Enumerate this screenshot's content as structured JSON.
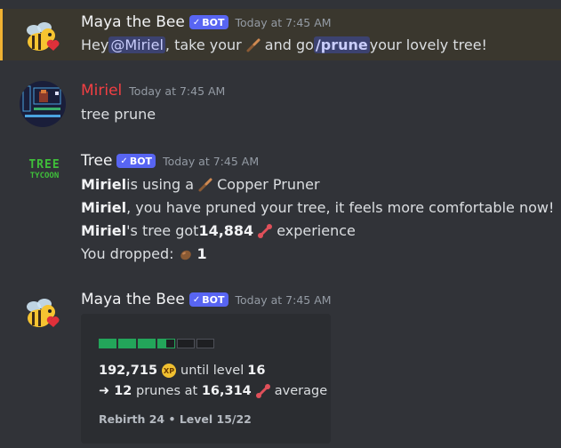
{
  "messages": [
    {
      "author": "Maya the Bee",
      "badge": "BOT",
      "timestamp": "Today at 7:45 AM",
      "line": {
        "p1": "Hey ",
        "mention": "@Miriel",
        "p2": ", take your ",
        "p3": " and go ",
        "command": "/prune",
        "p4": " your lovely tree!"
      }
    },
    {
      "author": "Miriel",
      "timestamp": "Today at 7:45 AM",
      "text": "tree prune"
    },
    {
      "author": "Tree",
      "badge": "BOT",
      "timestamp": "Today at 7:45 AM",
      "avatar_text_top": "TREE",
      "avatar_text_bottom": "TYCOON",
      "lines": {
        "l1_user": "Miriel",
        "l1_text": " is using a ",
        "l1_item": " Copper Pruner",
        "l2_user": "Miriel",
        "l2_text": ", you have pruned your tree, it feels more comfortable now!",
        "l3_user": "Miriel",
        "l3_text": "'s tree got ",
        "l3_amount": "14,884",
        "l3_suffix": " experience",
        "l4_text": "You dropped: ",
        "l4_amount": "1"
      }
    },
    {
      "author": "Maya the Bee",
      "badge": "BOT",
      "timestamp": "Today at 7:45 AM",
      "embed": {
        "progress_segments_filled": 3.5,
        "progress_segments_total": 6,
        "xp_remaining": "192,715",
        "xp_icon_label": "XP",
        "until_text": " until level ",
        "next_level": "16",
        "arrow": "➜ ",
        "prunes": "12",
        "prunes_text": " prunes at ",
        "avg_xp": "16,314",
        "average_text": " average",
        "footer": "Rebirth 24 • Level 15/22"
      }
    }
  ],
  "colors": {
    "background": "#313338",
    "highlight": "#3a372e",
    "highlight_border": "#f0b232",
    "bot_badge": "#5865f2",
    "miriel_name": "#f23f43",
    "progress_fill": "#23a55a"
  }
}
